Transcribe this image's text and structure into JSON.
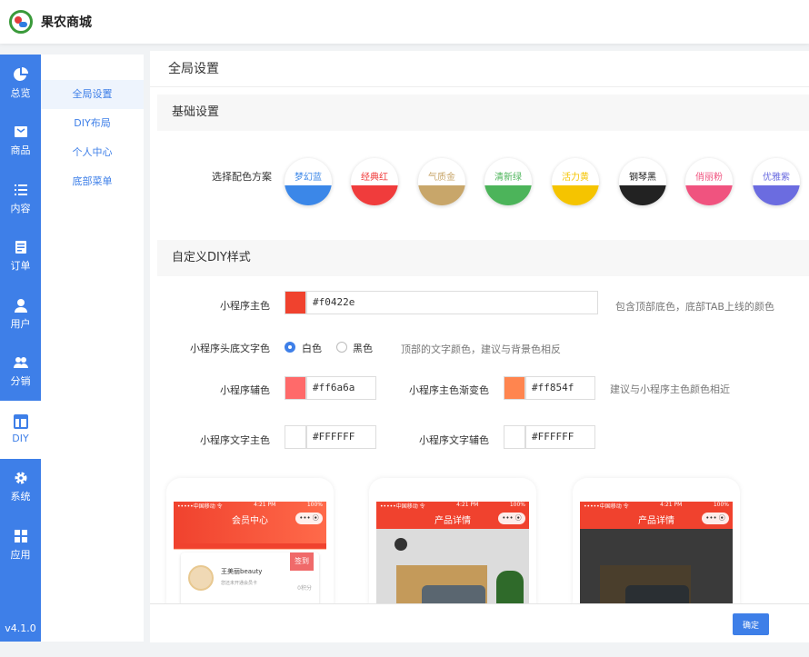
{
  "app": {
    "brand": "果农商城",
    "version": "v4.1.0"
  },
  "sidebar": {
    "items": [
      {
        "label": "总览",
        "icon": "pie-chart-icon"
      },
      {
        "label": "商品",
        "icon": "inbox-icon"
      },
      {
        "label": "内容",
        "icon": "list-icon"
      },
      {
        "label": "订单",
        "icon": "document-icon"
      },
      {
        "label": "用户",
        "icon": "user-icon"
      },
      {
        "label": "分销",
        "icon": "users-icon"
      },
      {
        "label": "DIY",
        "icon": "layout-icon"
      },
      {
        "label": "系统",
        "icon": "gear-icon"
      },
      {
        "label": "应用",
        "icon": "grid-icon"
      }
    ],
    "active_index": 6
  },
  "subnav": {
    "items": [
      "全局设置",
      "DIY布局",
      "个人中心",
      "底部菜单"
    ],
    "active_index": 0
  },
  "page": {
    "title": "全局设置"
  },
  "basic": {
    "section_title": "基础设置",
    "scheme_label": "选择配色方案",
    "schemes": [
      {
        "name": "梦幻蓝",
        "color": "#3b87e8"
      },
      {
        "name": "经典红",
        "color": "#f03c3c"
      },
      {
        "name": "气质金",
        "color": "#c8a66a"
      },
      {
        "name": "清新绿",
        "color": "#4cb45a"
      },
      {
        "name": "活力黄",
        "color": "#f5c400"
      },
      {
        "name": "钢琴黑",
        "color": "#222222"
      },
      {
        "name": "俏丽粉",
        "color": "#f0537f"
      },
      {
        "name": "优雅紫",
        "color": "#6b6ce0"
      }
    ]
  },
  "diy": {
    "section_title": "自定义DIY样式",
    "main_color": {
      "label": "小程序主色",
      "value": "#f0422e",
      "hint": "包含顶部底色，底部TAB上线的颜色"
    },
    "header_text": {
      "label": "小程序头底文字色",
      "options": [
        "白色",
        "黑色"
      ],
      "selected": "白色",
      "hint": "顶部的文字颜色，建议与背景色相反"
    },
    "aux_color": {
      "label": "小程序辅色",
      "value": "#ff6a6a"
    },
    "gradient_color": {
      "label": "小程序主色渐变色",
      "value": "#ff854f",
      "hint": "建议与小程序主色颜色相近"
    },
    "text_main": {
      "label": "小程序文字主色",
      "value": "#FFFFFF"
    },
    "text_aux": {
      "label": "小程序文字辅色",
      "value": "#FFFFFF"
    }
  },
  "previews": [
    {
      "status_left": "•••••中国移动 令",
      "status_time": "4:21 PM",
      "status_right": "100%",
      "title": "会员中心",
      "capsule": "••• ⦿",
      "user_name": "王美丽beauty",
      "user_sub": "您还未开通会员卡",
      "signin": "签到",
      "points": "0积分"
    },
    {
      "status_left": "•••••中国移动 令",
      "status_time": "4:21 PM",
      "status_right": "100%",
      "title": "产品详情",
      "capsule": "••• ⦿"
    },
    {
      "status_left": "•••••中国移动 令",
      "status_time": "4:21 PM",
      "status_right": "100%",
      "title": "产品详情",
      "capsule": "••• ⦿"
    }
  ],
  "footer": {
    "ok_label": "确定"
  }
}
